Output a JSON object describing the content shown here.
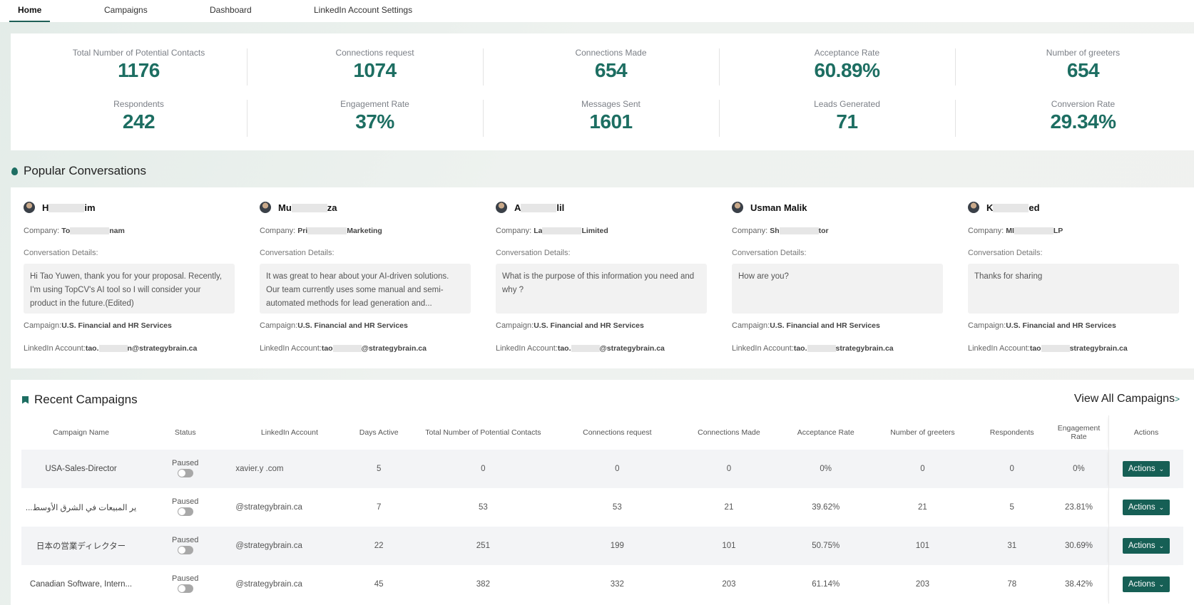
{
  "nav": {
    "tabs": [
      {
        "label": "Home",
        "active": true
      },
      {
        "label": "Campaigns",
        "active": false
      },
      {
        "label": "Dashboard",
        "active": false
      },
      {
        "label": "LinkedIn Account Settings",
        "active": false
      }
    ]
  },
  "stats": [
    {
      "label": "Total Number of Potential Contacts",
      "value": "1176"
    },
    {
      "label": "Connections request",
      "value": "1074"
    },
    {
      "label": "Connections Made",
      "value": "654"
    },
    {
      "label": "Acceptance Rate",
      "value": "60.89%"
    },
    {
      "label": "Number of greeters",
      "value": "654"
    },
    {
      "label": "Respondents",
      "value": "242"
    },
    {
      "label": "Engagement Rate",
      "value": "37%"
    },
    {
      "label": "Messages Sent",
      "value": "1601"
    },
    {
      "label": "Leads Generated",
      "value": "71"
    },
    {
      "label": "Conversion Rate",
      "value": "29.34%"
    }
  ],
  "popular": {
    "title": "Popular Conversations",
    "company_label": "Company:",
    "details_label": "Conversation Details:",
    "campaign_label": "Campaign:",
    "account_label": "LinkedIn Account:",
    "items": [
      {
        "name_start": "H",
        "name_end": "im",
        "company_start": "To",
        "company_end": "nam",
        "message": "Hi Tao Yuwen, thank you for your proposal. Recently, I'm using TopCV's AI tool so I will consider your product in the future.(Edited)",
        "campaign": "U.S. Financial and HR Services",
        "account_start": "tao.",
        "account_end": "n@strategybrain.ca"
      },
      {
        "name_start": "Mu",
        "name_end": "za",
        "company_start": "Pri",
        "company_end": "Marketing",
        "message": "It was great to hear about your AI-driven solutions. Our team currently uses some manual and semi-automated methods for lead generation and...",
        "campaign": "U.S. Financial and HR Services",
        "account_start": "tao",
        "account_end": "@strategybrain.ca"
      },
      {
        "name_start": "A",
        "name_end": "lil",
        "company_start": "La",
        "company_end": "Limited",
        "message": "What is the purpose of this information you need and why ?",
        "campaign": "U.S. Financial and HR Services",
        "account_start": "tao.",
        "account_end": "@strategybrain.ca"
      },
      {
        "name_start": "Usman Malik",
        "name_end": "",
        "company_start": "Sh",
        "company_end": "tor",
        "message": "How are you?",
        "campaign": "U.S. Financial and HR Services",
        "account_start": "tao.",
        "account_end": "strategybrain.ca"
      },
      {
        "name_start": "K",
        "name_end": "ed",
        "company_start": "MI",
        "company_end": "LP",
        "message": "Thanks for sharing",
        "campaign": "U.S. Financial and HR Services",
        "account_start": "tao",
        "account_end": "strategybrain.ca"
      }
    ]
  },
  "recent": {
    "title": "Recent Campaigns",
    "view_all": "View All Campaigns",
    "columns": [
      "Campaign Name",
      "Status",
      "LinkedIn Account",
      "Days Active",
      "Total Number of Potential Contacts",
      "Connections request",
      "Connections Made",
      "Acceptance Rate",
      "Number of greeters",
      "Respondents",
      "Engagement Rate",
      "Actions"
    ],
    "rows": [
      {
        "name": "USA-Sales-Director",
        "status": "Paused",
        "account": "xavier.y            .com",
        "days": "5",
        "potential": "0",
        "requests": "0",
        "made": "0",
        "acceptance": "0%",
        "greeters": "0",
        "respondents": "0",
        "engagement": "0%",
        "action": "Actions"
      },
      {
        "name": "...ير المبيعات في الشرق الأوسط",
        "status": "Paused",
        "account": "@strategybrain.ca",
        "days": "7",
        "potential": "53",
        "requests": "53",
        "made": "21",
        "acceptance": "39.62%",
        "greeters": "21",
        "respondents": "5",
        "engagement": "23.81%",
        "action": "Actions"
      },
      {
        "name": "日本の営業ディレクター",
        "status": "Paused",
        "account": "@strategybrain.ca",
        "days": "22",
        "potential": "251",
        "requests": "199",
        "made": "101",
        "acceptance": "50.75%",
        "greeters": "101",
        "respondents": "31",
        "engagement": "30.69%",
        "action": "Actions"
      },
      {
        "name": "Canadian Software, Intern...",
        "status": "Paused",
        "account": "@strategybrain.ca",
        "days": "45",
        "potential": "382",
        "requests": "332",
        "made": "203",
        "acceptance": "61.14%",
        "greeters": "203",
        "respondents": "78",
        "engagement": "38.42%",
        "action": "Actions"
      }
    ]
  }
}
